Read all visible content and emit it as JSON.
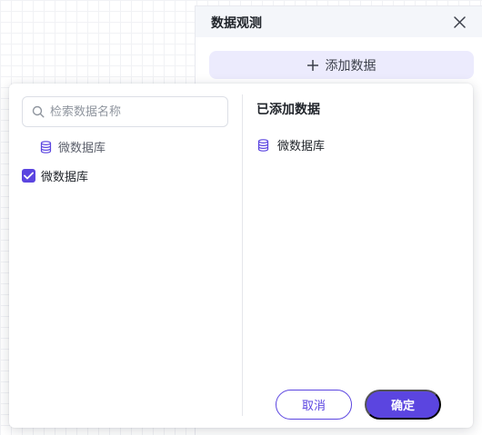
{
  "drawer": {
    "title": "数据观测",
    "add_button_label": "添加数据"
  },
  "popover": {
    "search": {
      "placeholder": "检索数据名称",
      "value": ""
    },
    "tree_item_label": "微数据库",
    "checked_item_label": "微数据库",
    "checked": true,
    "added_title": "已添加数据",
    "added_items": [
      "微数据库"
    ],
    "cancel_label": "取消",
    "confirm_label": "确定"
  },
  "colors": {
    "accent": "#5b45e0",
    "accent_soft": "#ecebfd",
    "header_bg": "#f4f6fa"
  },
  "icons": {
    "close": "close-icon",
    "add": "plus-icon",
    "search": "search-icon",
    "database": "database-icon",
    "check": "check-icon"
  }
}
